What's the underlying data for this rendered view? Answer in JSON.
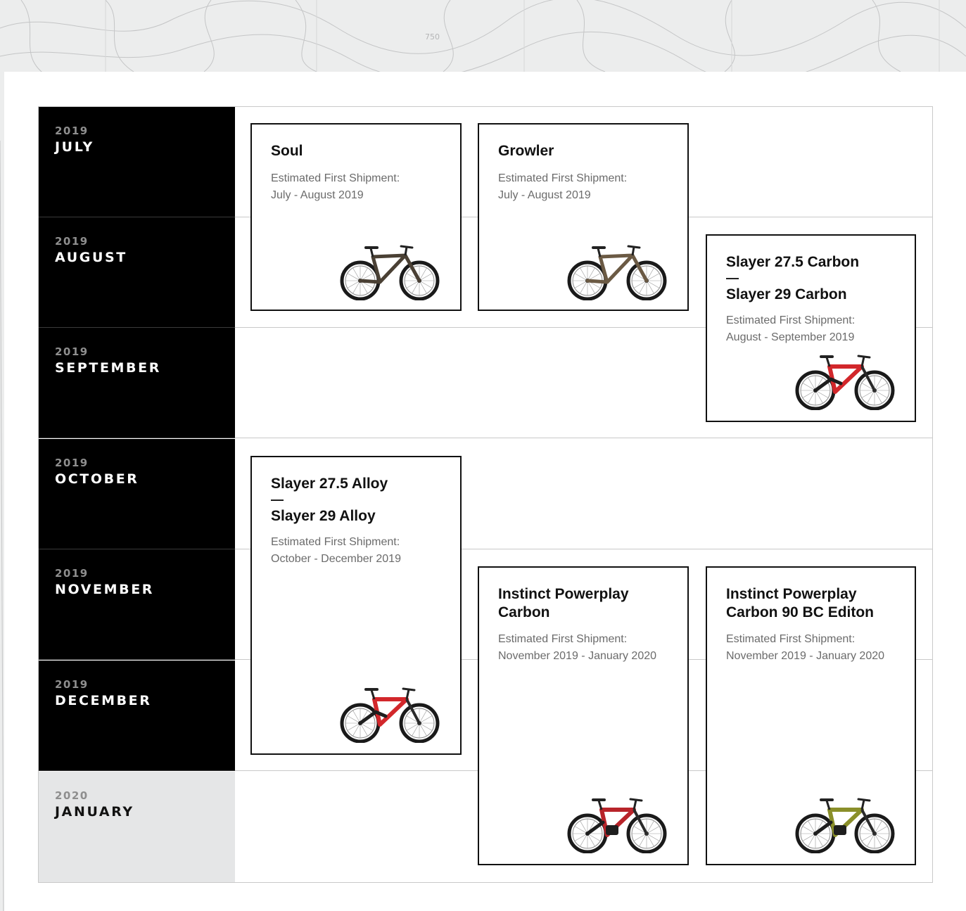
{
  "background": {
    "contour_label": "750"
  },
  "colors": {
    "month_bg": "#000000",
    "month_bg_future": "#e5e6e7",
    "year_text": "#8e8e8e",
    "card_border": "#111111",
    "shipment_text": "#6b6b6b"
  },
  "months": [
    {
      "year": "2019",
      "name": "JULY"
    },
    {
      "year": "2019",
      "name": "AUGUST"
    },
    {
      "year": "2019",
      "name": "SEPTEMBER"
    },
    {
      "year": "2019",
      "name": "OCTOBER"
    },
    {
      "year": "2019",
      "name": "NOVEMBER"
    },
    {
      "year": "2019",
      "name": "DECEMBER"
    },
    {
      "year": "2020",
      "name": "JANUARY"
    }
  ],
  "cards": {
    "soul": {
      "title": "Soul",
      "shipment_label": "Estimated First Shipment:",
      "shipment_dates": "July - August 2019",
      "bike_color": "#4a4034"
    },
    "growler": {
      "title": "Growler",
      "shipment_label": "Estimated First Shipment:",
      "shipment_dates": "July - August 2019",
      "bike_color": "#6b5a44"
    },
    "slayer_carbon": {
      "title_1": "Slayer 27.5 Carbon",
      "separator": "—",
      "title_2": "Slayer 29 Carbon",
      "shipment_label": "Estimated First Shipment:",
      "shipment_dates": "August - September 2019",
      "bike_color": "#d2272b"
    },
    "slayer_alloy": {
      "title_1": "Slayer 27.5 Alloy",
      "separator": "—",
      "title_2": "Slayer 29 Alloy",
      "shipment_label": "Estimated First Shipment:",
      "shipment_dates": "October - December 2019",
      "bike_color": "#d2272b"
    },
    "instinct_carbon": {
      "title_1": "Instinct Powerplay",
      "title_2": "Carbon",
      "shipment_label": "Estimated First Shipment:",
      "shipment_dates": "November 2019 - January 2020",
      "bike_color": "#b8242a"
    },
    "instinct_bc": {
      "title_1": "Instinct Powerplay",
      "title_2": "Carbon 90 BC Editon",
      "shipment_label": "Estimated First Shipment:",
      "shipment_dates": "November 2019 - January 2020",
      "bike_color": "#8a8f2a"
    }
  }
}
